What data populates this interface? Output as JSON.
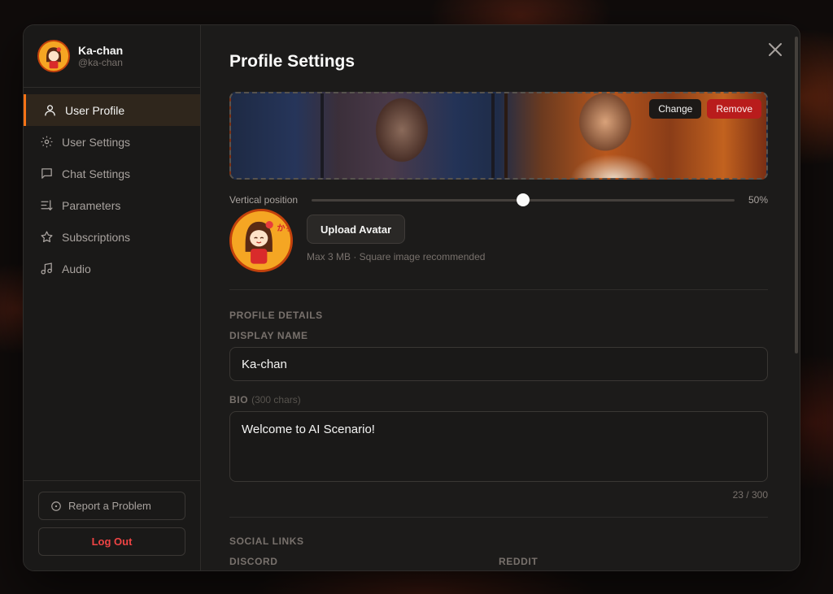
{
  "user": {
    "name": "Ka-chan",
    "handle": "@ka-chan"
  },
  "nav": {
    "items": [
      {
        "label": "User Profile",
        "icon": "user-icon",
        "active": true
      },
      {
        "label": "User Settings",
        "icon": "settings-sun-icon",
        "active": false
      },
      {
        "label": "Chat Settings",
        "icon": "chat-bubble-icon",
        "active": false
      },
      {
        "label": "Parameters",
        "icon": "sliders-list-icon",
        "active": false
      },
      {
        "label": "Subscriptions",
        "icon": "star-icon",
        "active": false
      },
      {
        "label": "Audio",
        "icon": "music-note-icon",
        "active": false
      }
    ]
  },
  "footer": {
    "report_label": "Report a Problem",
    "logout_label": "Log Out"
  },
  "main": {
    "title": "Profile Settings",
    "banner": {
      "change_label": "Change",
      "remove_label": "Remove"
    },
    "vertical_position": {
      "label": "Vertical position",
      "value_text": "50%",
      "value": 0.5
    },
    "avatar": {
      "upload_label": "Upload Avatar",
      "hint": "Max 3 MB · Square image recommended",
      "text": "かちゃん"
    },
    "profile_details": {
      "section_title": "PROFILE DETAILS",
      "display_name_label": "DISPLAY NAME",
      "display_name_value": "Ka-chan",
      "bio_label": "BIO",
      "bio_sub": "(300 chars)",
      "bio_value": "Welcome to AI Scenario!",
      "bio_counter": "23 / 300"
    },
    "social_links": {
      "section_title": "SOCIAL LINKS",
      "discord_label": "DISCORD",
      "reddit_label": "REDDIT"
    }
  },
  "colors": {
    "accent": "#f97316",
    "danger": "#ef4444",
    "remove_bg": "#b91c1c"
  }
}
